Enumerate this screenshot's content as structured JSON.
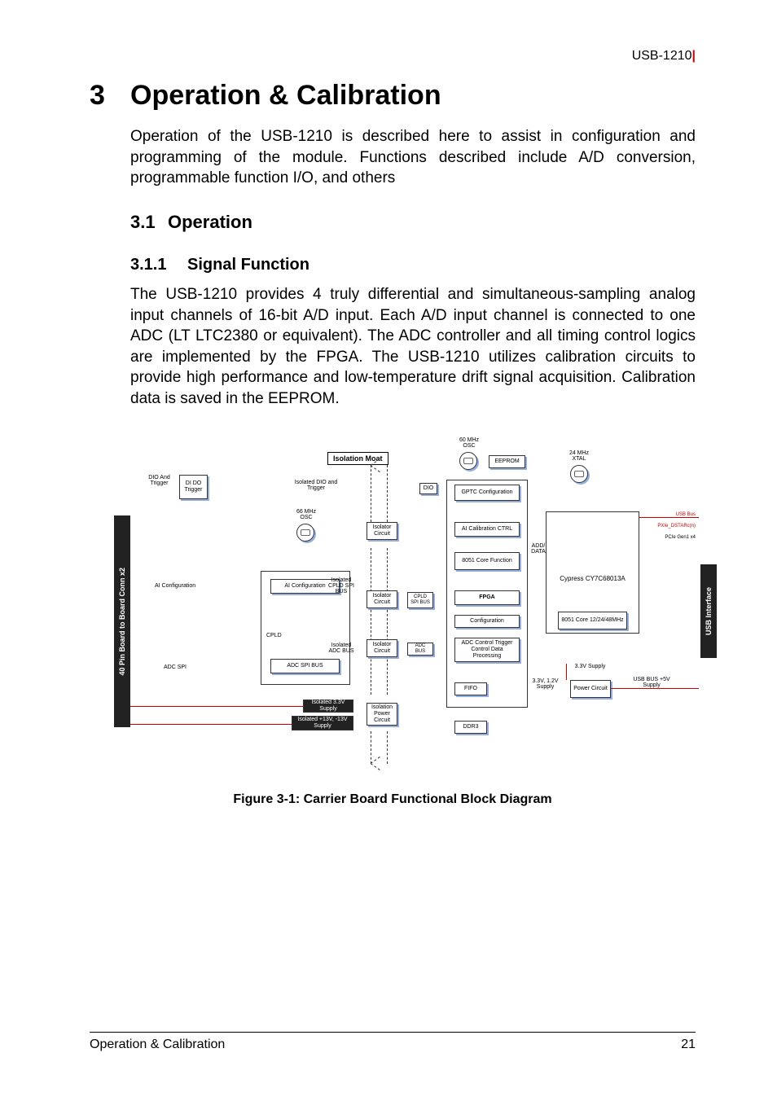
{
  "header": {
    "product": "USB-1210",
    "bar": "|"
  },
  "chapter": {
    "no": "3",
    "title": "Operation & Calibration"
  },
  "intro": "Operation of the USB-1210 is described here to assist in configuration and programming of the module. Functions described include A/D conversion, programmable function I/O, and others",
  "section": {
    "no": "3.1",
    "title": "Operation"
  },
  "subsection": {
    "no": "3.1.1",
    "title": "Signal Function"
  },
  "body": "The USB-1210 provides 4 truly differential and simultaneous-sampling analog input channels of 16-bit A/D input. Each A/D input channel is connected to one ADC (LT LTC2380 or equivalent). The ADC controller and all timing control logics are implemented by the FPGA. The USB-1210 utilizes calibration circuits to provide high performance and low-temperature drift signal acquisition. Calibration data is saved in the EEPROM.",
  "figure": {
    "caption": "Figure 3-1: Carrier Board Functional Block Diagram"
  },
  "footer": {
    "left": "Operation & Calibration",
    "page": "21"
  },
  "diagram": {
    "left_bar": "40 Pin Board to Board Conn x2",
    "right_bar": "USB Interface",
    "iso_moat": "Isolation Moat",
    "osc60": "60 MHz OSC",
    "osc24": "24 MHz XTAL",
    "osc66": "66 MHz OSC",
    "dio_and_trigger": "DIO And Trigger",
    "di_do_trigger": "DI DO Trigger",
    "isolated_dio": "Isolated DIO and Trigger",
    "dio": "DIO",
    "eeprom": "EEPROM",
    "gptc": "GPTC Configuration",
    "ai_cal": "AI Calibration CTRL",
    "core8051": "8051 Core Function",
    "isolator": "Isolator Circuit",
    "iso_cpld_spi": "Isolated CPLD SPI BUS",
    "cpld_spi_bus": "CPLD SPI BUS",
    "fpga": "FPGA",
    "cypress": "Cypress CY7C68013A",
    "settings": "Configuration",
    "core8051b": "8051 Core 12/24/48MHz",
    "iso_adc_bus": "Isolated ADC BUS",
    "adc_bus": "ADC BUS",
    "adc_ctrl": "ADC Control Trigger Control Data Processing",
    "fifo": "FIFO",
    "ddr3": "DDR3",
    "ai_config_lbl": "AI Configuration",
    "ai_config": "AI Configuration",
    "cpld": "CPLD",
    "adc_spi_lbl": "ADC SPI",
    "adc_spi": "ADC SPI BUS",
    "iso33": "Isolated 3.3V Supply",
    "iso13": "Isolated +13V, -13V Supply",
    "iso_power": "Isolation Power Circuit",
    "power": "Power Circuit",
    "add_data": "ADD/ DATA",
    "supply33_12": "3.3V, 1.2V Supply",
    "supply33": "3.3V Supply",
    "usb5v": "USB BUS +5V Supply",
    "usb_bus": "USB Bus",
    "pxie": "PXIe_DSTARc(n)",
    "pcie": "PCIe Gen1 x4"
  }
}
